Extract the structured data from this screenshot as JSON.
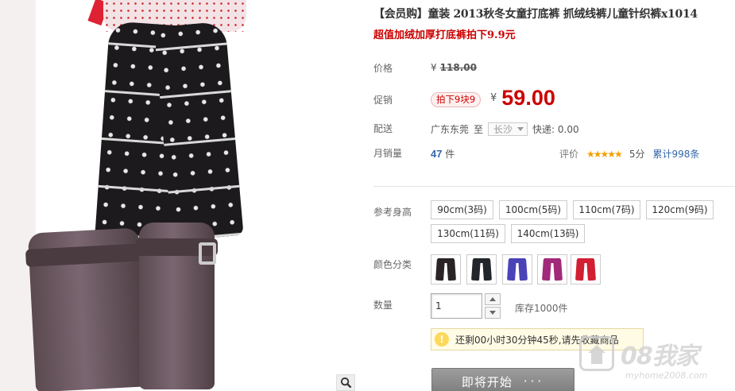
{
  "product": {
    "title": "【会员购】童装 2013秋冬女童打底裤 抓绒线裤儿童针织裤x1014",
    "subtitle": "超值加绒加厚打底裤拍下9.9元"
  },
  "price": {
    "label": "价格",
    "currency": "¥",
    "original": "118.00"
  },
  "promo": {
    "label": "促销",
    "tag": "拍下9块9",
    "currency": "¥",
    "price": "59.00"
  },
  "shipping": {
    "label": "配送",
    "from": "广东东莞",
    "to_word": "至",
    "destination": "长沙",
    "express": "快递: 0.00"
  },
  "sales": {
    "label": "月销量",
    "count": "47",
    "unit": "件",
    "rating_label": "评价",
    "stars": "★★★★★",
    "score": "5分",
    "total": "累计998条"
  },
  "sizes": {
    "label": "参考身高",
    "options": [
      "90cm(3码)",
      "100cm(5码)",
      "110cm(7码)",
      "120cm(9码)",
      "130cm(11码)",
      "140cm(13码)"
    ]
  },
  "colors": {
    "label": "颜色分类",
    "swatches": [
      "#2a2326",
      "#23252c",
      "#4b42b8",
      "#a12a7a",
      "#d21f32"
    ]
  },
  "quantity": {
    "label": "数量",
    "value": "1",
    "stock": "库存1000件"
  },
  "notice": {
    "icon": "bulb-icon",
    "text": "还剩00小时30分钟45秒,请先收藏商品"
  },
  "buy": {
    "label": "即将开始",
    "dots": "···"
  },
  "watermark": {
    "brand": "08我家",
    "url": "myhome2008.com"
  },
  "icons": {
    "zoom": "magnifier-icon"
  }
}
